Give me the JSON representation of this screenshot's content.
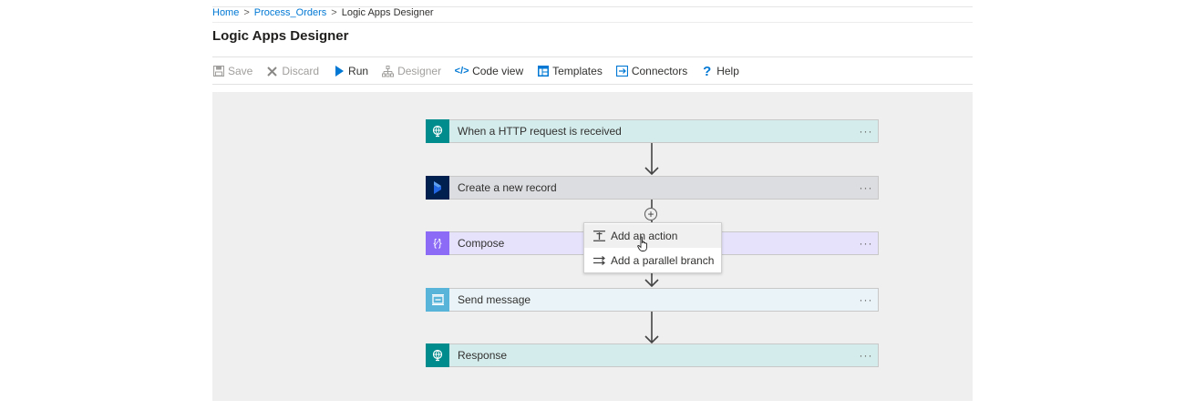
{
  "breadcrumb": {
    "home": "Home",
    "sep": ">",
    "workflow": "Process_Orders",
    "current": "Logic Apps Designer"
  },
  "page_title": "Logic Apps Designer",
  "toolbar": {
    "save": "Save",
    "discard": "Discard",
    "run": "Run",
    "designer": "Designer",
    "code_view": "Code view",
    "templates": "Templates",
    "connectors": "Connectors",
    "help": "Help"
  },
  "steps": [
    {
      "title": "When a HTTP request is received",
      "icon": "http-request-icon",
      "color": "#008c8c",
      "bg": "#d4eceb"
    },
    {
      "title": "Create a new record",
      "icon": "dynamics-icon",
      "color": "#002050",
      "bg": "#dcdde1"
    },
    {
      "title": "Compose",
      "icon": "compose-icon",
      "color": "#8c6cf6",
      "bg": "#e6e2fb"
    },
    {
      "title": "Send message",
      "icon": "service-bus-icon",
      "color": "#59b4d9",
      "bg": "#eaf4f8"
    },
    {
      "title": "Response",
      "icon": "response-icon",
      "color": "#008c8c",
      "bg": "#d4eceb"
    }
  ],
  "more_label": "···",
  "add_symbol": "+",
  "insert_menu": {
    "add_action": "Add an action",
    "add_parallel": "Add a parallel branch"
  }
}
